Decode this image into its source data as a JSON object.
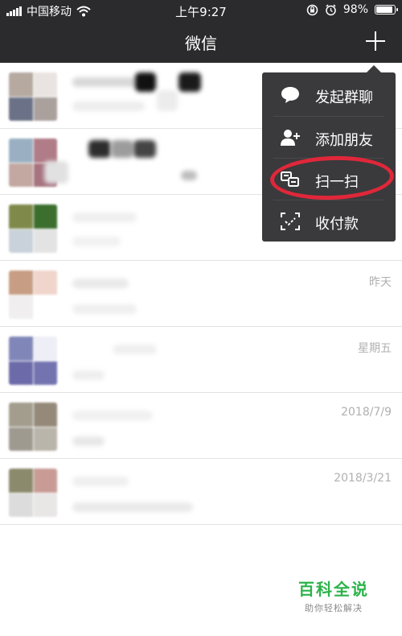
{
  "status_bar": {
    "carrier": "中国移动",
    "time": "上午9:27",
    "battery": "98%",
    "battery_level": 0.98
  },
  "nav": {
    "title": "微信"
  },
  "menu": {
    "items": [
      {
        "label": "发起群聊",
        "icon": "chat-bubble-icon"
      },
      {
        "label": "添加朋友",
        "icon": "add-friend-icon"
      },
      {
        "label": "扫一扫",
        "icon": "scan-icon"
      },
      {
        "label": "收付款",
        "icon": "payment-icon"
      }
    ],
    "highlight_color": "#e0273a"
  },
  "chats": [
    {
      "time": ""
    },
    {
      "time": ""
    },
    {
      "time": ""
    },
    {
      "time": "昨天"
    },
    {
      "time": "星期五"
    },
    {
      "time": "2018/7/9"
    },
    {
      "time": "2018/3/21"
    }
  ],
  "watermark": {
    "title": "百科全说",
    "subtitle": "助你轻松解决"
  }
}
